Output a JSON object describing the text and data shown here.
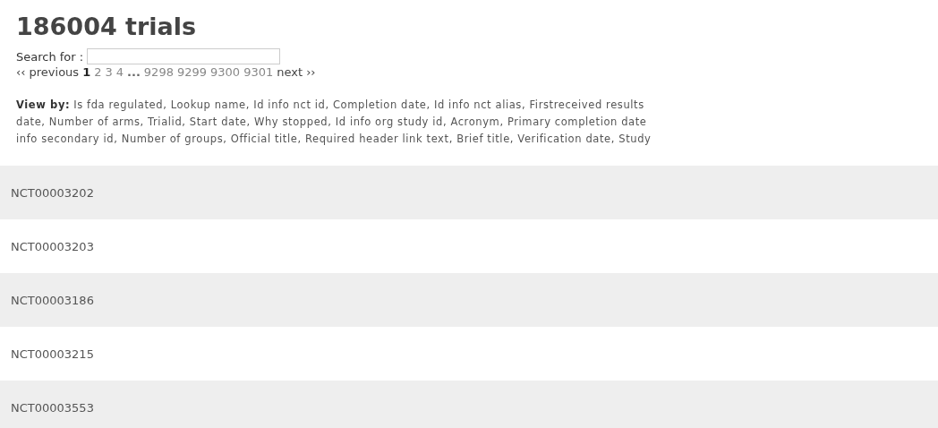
{
  "title": "186004 trials",
  "search": {
    "label": "Search for :"
  },
  "pagination": {
    "previous": "‹‹ previous",
    "next": "next ››",
    "items": [
      {
        "label": "1",
        "selected": true
      },
      {
        "label": "2",
        "selected": false
      },
      {
        "label": "3",
        "selected": false
      },
      {
        "label": "4",
        "selected": false
      },
      {
        "label": "...",
        "kind": "gap"
      },
      {
        "label": "9298",
        "selected": false
      },
      {
        "label": "9299",
        "selected": false
      },
      {
        "label": "9300",
        "selected": false
      },
      {
        "label": "9301",
        "selected": false
      }
    ]
  },
  "view_by": {
    "label": "View by:",
    "lines": [
      "Is fda regulated, Lookup name, Id info nct id, Completion date, Id info nct alias, Firstreceived results",
      "date, Number of arms, Trialid, Start date, Why stopped, Id info org study id, Acronym, Primary completion date",
      "info secondary id, Number of groups, Official title, Required header link text, Brief title, Verification date, Study"
    ]
  },
  "rows": [
    {
      "id": "NCT00003202"
    },
    {
      "id": "NCT00003203"
    },
    {
      "id": "NCT00003186"
    },
    {
      "id": "NCT00003215"
    },
    {
      "id": "NCT00003553"
    }
  ]
}
